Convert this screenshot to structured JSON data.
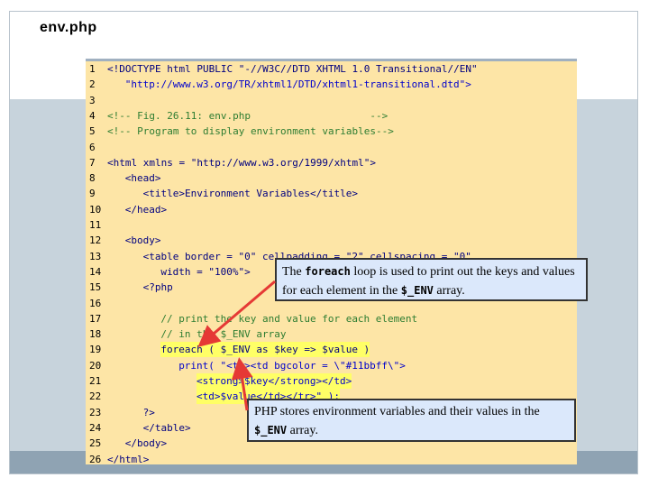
{
  "slide": {
    "title": "env.php"
  },
  "code_lines": [
    {
      "n": "1",
      "indent": "",
      "text": "<!DOCTYPE html PUBLIC \"-//W3C//DTD XHTML 1.0 Transitional//EN\"",
      "style": "kw"
    },
    {
      "n": "2",
      "indent": "   ",
      "text": "\"http://www.w3.org/TR/xhtml1/DTD/xhtml1-transitional.dtd\">",
      "style": "str"
    },
    {
      "n": "3",
      "indent": "",
      "text": "",
      "style": "plain"
    },
    {
      "n": "4",
      "indent": "",
      "text": "<!-- Fig. 26.11: env.php                    -->",
      "style": "cmt"
    },
    {
      "n": "5",
      "indent": "",
      "text": "<!-- Program to display environment variables-->",
      "style": "cmt"
    },
    {
      "n": "6",
      "indent": "",
      "text": "",
      "style": "plain"
    },
    {
      "n": "7",
      "indent": "",
      "text": "<html xmlns = \"http://www.w3.org/1999/xhtml\">",
      "style": "kw"
    },
    {
      "n": "8",
      "indent": "   ",
      "text": "<head>",
      "style": "kw"
    },
    {
      "n": "9",
      "indent": "      ",
      "text": "<title>Environment Variables</title>",
      "style": "kw"
    },
    {
      "n": "10",
      "indent": "   ",
      "text": "</head>",
      "style": "kw"
    },
    {
      "n": "11",
      "indent": "",
      "text": "",
      "style": "plain"
    },
    {
      "n": "12",
      "indent": "   ",
      "text": "<body>",
      "style": "kw"
    },
    {
      "n": "13",
      "indent": "      ",
      "text": "<table border = \"0\" cellpadding = \"2\" cellspacing = \"0\"",
      "style": "kw"
    },
    {
      "n": "14",
      "indent": "         ",
      "text": "width = \"100%\">",
      "style": "kw"
    },
    {
      "n": "15",
      "indent": "      ",
      "text": "<?php",
      "style": "kw"
    },
    {
      "n": "16",
      "indent": "",
      "text": "",
      "style": "plain"
    },
    {
      "n": "17",
      "indent": "         ",
      "text": "// print the key and value for each element",
      "style": "cmt"
    },
    {
      "n": "18",
      "indent": "         ",
      "text": "// in the $_ENV array",
      "style": "cmt"
    },
    {
      "n": "19",
      "indent": "         ",
      "text": "foreach ( $_ENV as $key => $value )",
      "style": "kw"
    },
    {
      "n": "20",
      "indent": "            ",
      "text": "print( \"<tr><td bgcolor = \\\"#11bbff\\\">",
      "style": "str"
    },
    {
      "n": "21",
      "indent": "               ",
      "text": "<strong>$key</strong></td>",
      "style": "str"
    },
    {
      "n": "22",
      "indent": "               ",
      "text": "<td>$value</td></tr>\" );",
      "style": "str"
    },
    {
      "n": "23",
      "indent": "      ",
      "text": "?>",
      "style": "kw"
    },
    {
      "n": "24",
      "indent": "      ",
      "text": "</table>",
      "style": "kw"
    },
    {
      "n": "25",
      "indent": "   ",
      "text": "</body>",
      "style": "kw"
    },
    {
      "n": "26",
      "indent": "",
      "text": "</html>",
      "style": "kw"
    }
  ],
  "callouts": {
    "foreach": {
      "pre": "The ",
      "code1": "foreach",
      "mid": " loop is used to print out the keys and values for each element in the ",
      "code2": "$_ENV",
      "post": " array."
    },
    "env": {
      "pre": "PHP stores environment variables and their values in the ",
      "code": "$_ENV",
      "post": " array."
    }
  },
  "colors": {
    "code_background": "#fde5a6",
    "callout_background": "#dbe8fb",
    "arrow": "#e53935",
    "highlight": "#ffff66"
  }
}
